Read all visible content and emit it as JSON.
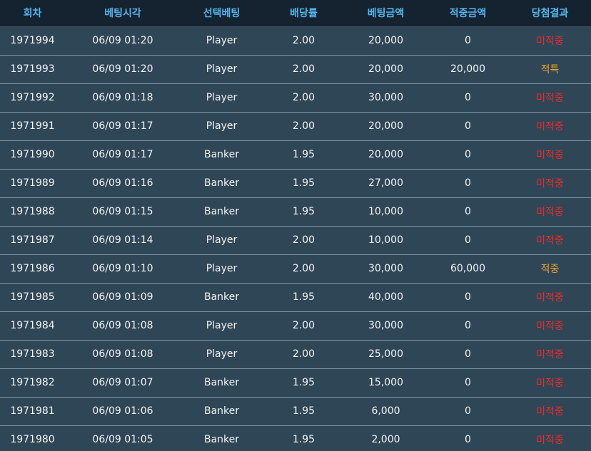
{
  "colors": {
    "header_bg": "#152230",
    "header_text": "#52b6ee",
    "row_bg": "#2f4657",
    "row_divider": "#7e97a6",
    "lose": "#ee2a2a",
    "win": "#f0a326"
  },
  "table": {
    "headers": [
      "회차",
      "베팅시각",
      "선택베팅",
      "배당률",
      "베팅금액",
      "적중금액",
      "당첨결과"
    ],
    "rows": [
      [
        "1971994",
        "06/09 01:20",
        "Player",
        "2.00",
        "20,000",
        "0",
        "미적중"
      ],
      [
        "1971993",
        "06/09 01:20",
        "Player",
        "2.00",
        "20,000",
        "20,000",
        "적특"
      ],
      [
        "1971992",
        "06/09 01:18",
        "Player",
        "2.00",
        "30,000",
        "0",
        "미적중"
      ],
      [
        "1971991",
        "06/09 01:17",
        "Player",
        "2.00",
        "20,000",
        "0",
        "미적중"
      ],
      [
        "1971990",
        "06/09 01:17",
        "Banker",
        "1.95",
        "20,000",
        "0",
        "미적중"
      ],
      [
        "1971989",
        "06/09 01:16",
        "Banker",
        "1.95",
        "27,000",
        "0",
        "미적중"
      ],
      [
        "1971988",
        "06/09 01:15",
        "Banker",
        "1.95",
        "10,000",
        "0",
        "미적중"
      ],
      [
        "1971987",
        "06/09 01:14",
        "Player",
        "2.00",
        "10,000",
        "0",
        "미적중"
      ],
      [
        "1971986",
        "06/09 01:10",
        "Player",
        "2.00",
        "30,000",
        "60,000",
        "적중"
      ],
      [
        "1971985",
        "06/09 01:09",
        "Banker",
        "1.95",
        "40,000",
        "0",
        "미적중"
      ],
      [
        "1971984",
        "06/09 01:08",
        "Player",
        "2.00",
        "30,000",
        "0",
        "미적중"
      ],
      [
        "1971983",
        "06/09 01:08",
        "Player",
        "2.00",
        "25,000",
        "0",
        "미적중"
      ],
      [
        "1971982",
        "06/09 01:07",
        "Banker",
        "1.95",
        "15,000",
        "0",
        "미적중"
      ],
      [
        "1971981",
        "06/09 01:06",
        "Banker",
        "1.95",
        "6,000",
        "0",
        "미적중"
      ],
      [
        "1971980",
        "06/09 01:05",
        "Banker",
        "1.95",
        "2,000",
        "0",
        "미적중"
      ]
    ]
  }
}
